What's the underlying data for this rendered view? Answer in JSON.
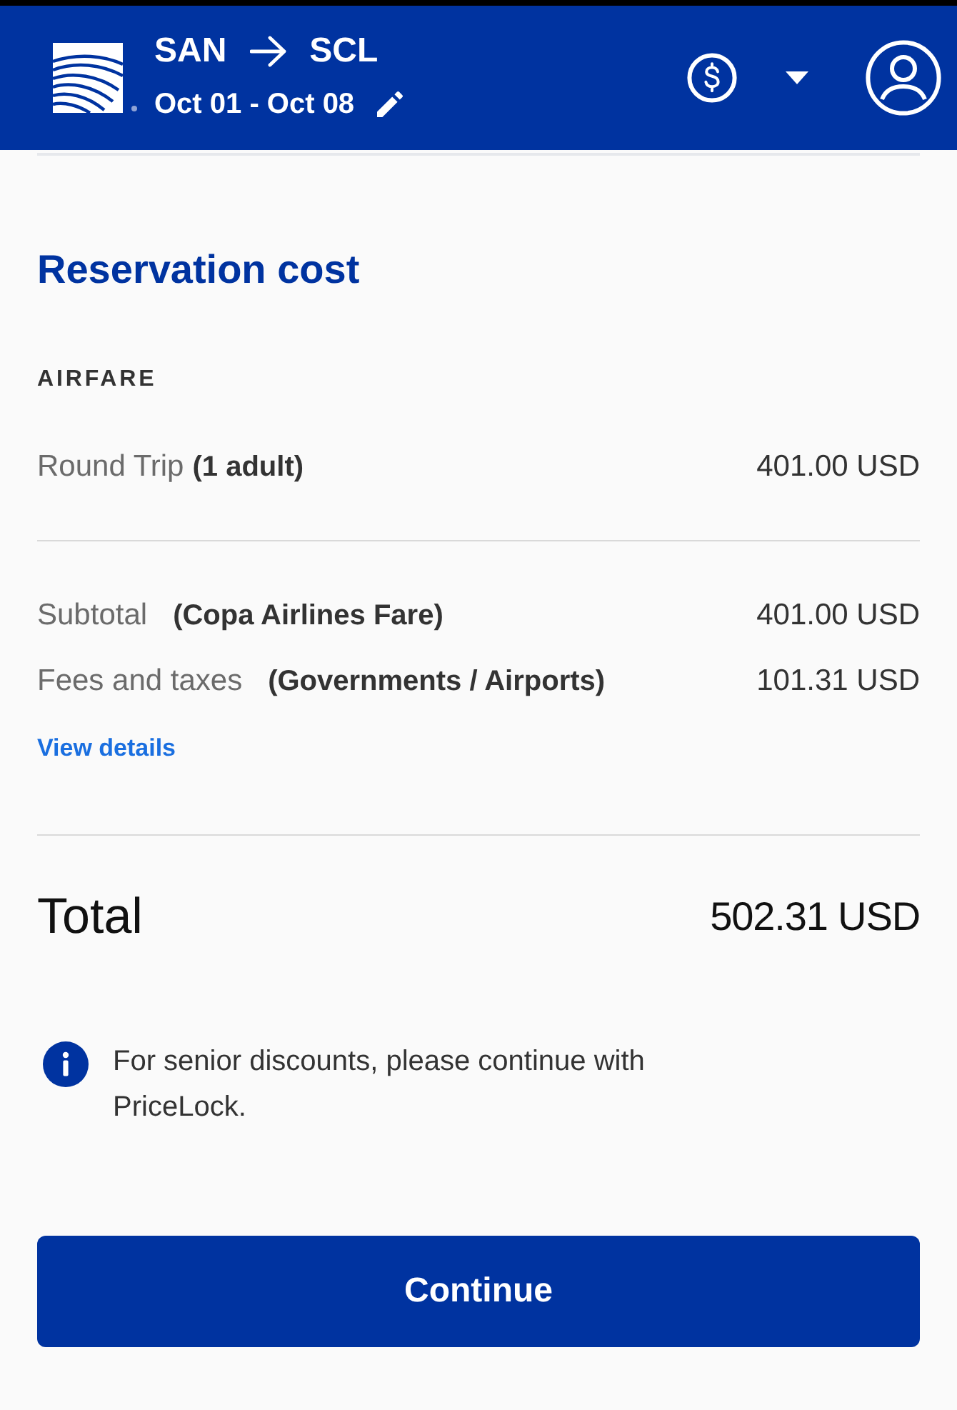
{
  "header": {
    "origin": "SAN",
    "destination": "SCL",
    "dates": "Oct 01 - Oct 08"
  },
  "title": "Reservation cost",
  "section_label": "AIRFARE",
  "fare_lines": [
    {
      "label": "Round Trip",
      "note": "(1 adult)",
      "amount": "401.00 USD"
    }
  ],
  "summary_lines": [
    {
      "label": "Subtotal",
      "note": "(Copa Airlines Fare)",
      "amount": "401.00 USD"
    },
    {
      "label": "Fees and taxes",
      "note": "(Governments / Airports)",
      "amount": "101.31 USD"
    }
  ],
  "details_link": "View details",
  "total": {
    "label": "Total",
    "amount": "502.31 USD"
  },
  "notice": "For senior discounts, please continue with PriceLock.",
  "continue_button": "Continue"
}
